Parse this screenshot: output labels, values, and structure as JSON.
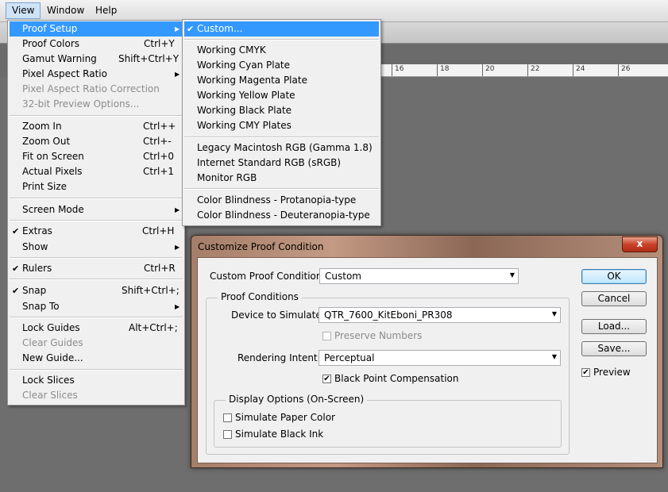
{
  "menubar": {
    "items": [
      "View",
      "Window",
      "Help"
    ]
  },
  "ruler": {
    "labels": [
      "16",
      "18",
      "20",
      "22",
      "24",
      "26"
    ]
  },
  "view_menu": {
    "items": [
      {
        "label": "Proof Setup",
        "shortcut": "",
        "submenu": true,
        "highlight": true
      },
      {
        "label": "Proof Colors",
        "shortcut": "Ctrl+Y"
      },
      {
        "label": "Gamut Warning",
        "shortcut": "Shift+Ctrl+Y"
      },
      {
        "label": "Pixel Aspect Ratio",
        "shortcut": "",
        "submenu": true
      },
      {
        "label": "Pixel Aspect Ratio Correction",
        "shortcut": "",
        "disabled": true
      },
      {
        "label": "32-bit Preview Options...",
        "shortcut": "",
        "disabled": true
      },
      {
        "label": "Zoom In",
        "shortcut": "Ctrl++"
      },
      {
        "label": "Zoom Out",
        "shortcut": "Ctrl+-"
      },
      {
        "label": "Fit on Screen",
        "shortcut": "Ctrl+0"
      },
      {
        "label": "Actual Pixels",
        "shortcut": "Ctrl+1"
      },
      {
        "label": "Print Size",
        "shortcut": ""
      },
      {
        "label": "Screen Mode",
        "shortcut": "",
        "submenu": true
      },
      {
        "label": "Extras",
        "shortcut": "Ctrl+H",
        "checked": true
      },
      {
        "label": "Show",
        "shortcut": "",
        "submenu": true
      },
      {
        "label": "Rulers",
        "shortcut": "Ctrl+R",
        "checked": true
      },
      {
        "label": "Snap",
        "shortcut": "Shift+Ctrl+;",
        "checked": true
      },
      {
        "label": "Snap To",
        "shortcut": "",
        "submenu": true
      },
      {
        "label": "Lock Guides",
        "shortcut": "Alt+Ctrl+;"
      },
      {
        "label": "Clear Guides",
        "shortcut": "",
        "disabled": true
      },
      {
        "label": "New Guide...",
        "shortcut": ""
      },
      {
        "label": "Lock Slices",
        "shortcut": ""
      },
      {
        "label": "Clear Slices",
        "shortcut": "",
        "disabled": true
      }
    ]
  },
  "proof_submenu": {
    "items": [
      {
        "label": "Custom...",
        "checked": true,
        "highlight": true
      },
      {
        "label": "Working CMYK"
      },
      {
        "label": "Working Cyan Plate"
      },
      {
        "label": "Working Magenta Plate"
      },
      {
        "label": "Working Yellow Plate"
      },
      {
        "label": "Working Black Plate"
      },
      {
        "label": "Working CMY Plates"
      },
      {
        "label": "Legacy Macintosh RGB (Gamma 1.8)"
      },
      {
        "label": "Internet Standard RGB (sRGB)"
      },
      {
        "label": "Monitor RGB"
      },
      {
        "label": "Color Blindness - Protanopia-type"
      },
      {
        "label": "Color Blindness - Deuteranopia-type"
      }
    ]
  },
  "dialog": {
    "title": "Customize Proof Condition",
    "close_label": "x",
    "custom_label": "Custom Proof Condition:",
    "custom_value": "Custom",
    "proof_group": "Proof Conditions",
    "device_label": "Device to Simulate:",
    "device_value": "QTR_7600_KitEboni_PR308",
    "preserve_label": "Preserve Numbers",
    "intent_label": "Rendering Intent:",
    "intent_value": "Perceptual",
    "bpc_label": "Black Point Compensation",
    "display_group": "Display Options (On-Screen)",
    "paper_label": "Simulate Paper Color",
    "ink_label": "Simulate Black Ink",
    "ok": "OK",
    "cancel": "Cancel",
    "load": "Load...",
    "save": "Save...",
    "preview": "Preview"
  },
  "colors": {
    "highlight": "#3399ff",
    "menu_bg": "#f0f0f0",
    "workspace": "#6b6b6b"
  }
}
